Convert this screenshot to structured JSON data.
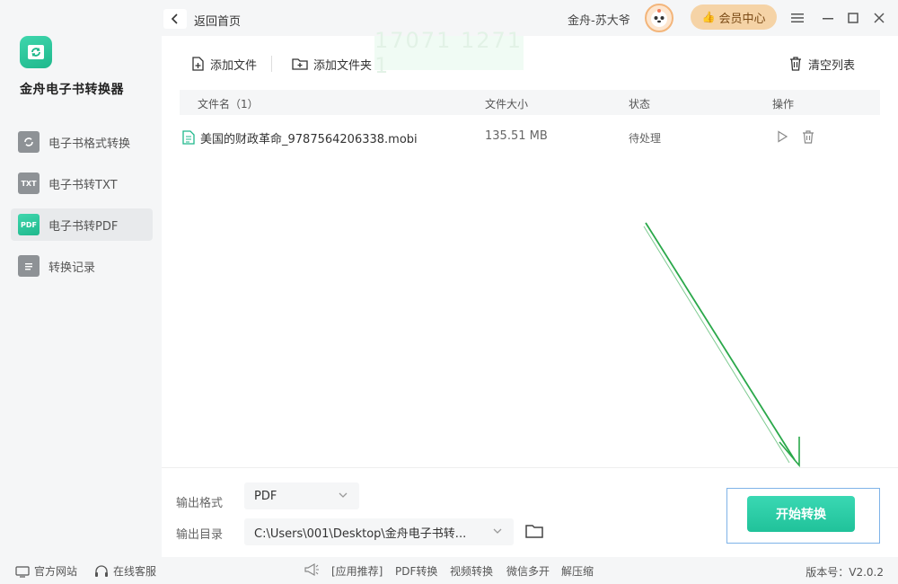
{
  "app": {
    "name": "金舟电子书转换器"
  },
  "sidebar": {
    "items": [
      {
        "label": "电子书格式转换",
        "icon": "convert-icon",
        "active": false
      },
      {
        "label": "电子书转TXT",
        "icon": "txt-icon",
        "icon_text": "TXT",
        "active": false
      },
      {
        "label": "电子书转PDF",
        "icon": "pdf-icon",
        "icon_text": "PDF",
        "active": true
      },
      {
        "label": "转换记录",
        "icon": "list-icon",
        "active": false
      }
    ]
  },
  "topbar": {
    "back_label": "返回首页",
    "user_name": "金舟-苏大爷",
    "vip_label": "会员中心"
  },
  "toolbar": {
    "add_file": "添加文件",
    "add_folder": "添加文件夹",
    "clear_list": "清空列表",
    "watermark_text": "17071 1271 1"
  },
  "table": {
    "headers": {
      "filename": "文件名（1）",
      "size": "文件大小",
      "status": "状态",
      "action": "操作"
    },
    "rows": [
      {
        "filename": "美国的财政革命_9787564206338.mobi",
        "size": "135.51 MB",
        "status": "待处理"
      }
    ]
  },
  "bottom": {
    "format_label": "输出格式",
    "format_value": "PDF",
    "dir_label": "输出目录",
    "dir_value": "C:\\Users\\001\\Desktop\\金舟电子书转...",
    "start_label": "开始转换"
  },
  "footer": {
    "website": "官方网站",
    "support": "在线客服",
    "links": [
      "[应用推荐]",
      "PDF转换",
      "视频转换",
      "微信多开",
      "解压缩"
    ],
    "version": "版本号：V2.0.2"
  },
  "colors": {
    "accent": "#20c29a",
    "vip": "#f5d3a6",
    "arrow": "#2aa84a"
  }
}
